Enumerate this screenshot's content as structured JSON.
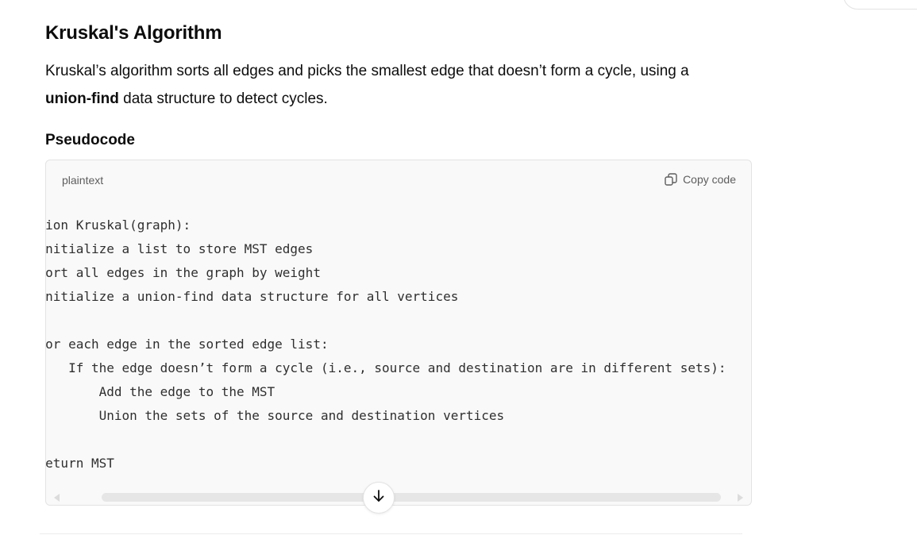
{
  "section": {
    "title": "Kruskal's Algorithm",
    "intro_before": "Kruskal’s algorithm sorts all edges and picks the smallest edge that doesn’t form a cycle, using a",
    "intro_bold": "union-find",
    "intro_after": " data structure to detect cycles.",
    "subtitle": "Pseudocode"
  },
  "code_block": {
    "language": "plaintext",
    "copy_label": "Copy code",
    "copy_icon": "copy-icon",
    "lines": [
      "function Kruskal(graph):",
      "    Initialize a list to store MST edges",
      "    Sort all edges in the graph by weight",
      "    Initialize a union-find data structure for all vertices",
      "",
      "    For each edge in the sorted edge list:",
      "        If the edge doesn’t form a cycle (i.e., source and destination are in different sets):",
      "            Add the edge to the MST",
      "            Union the sets of the source and destination vertices",
      "",
      "    Return MST"
    ]
  },
  "scroll_button": {
    "icon": "arrow-down-icon"
  }
}
